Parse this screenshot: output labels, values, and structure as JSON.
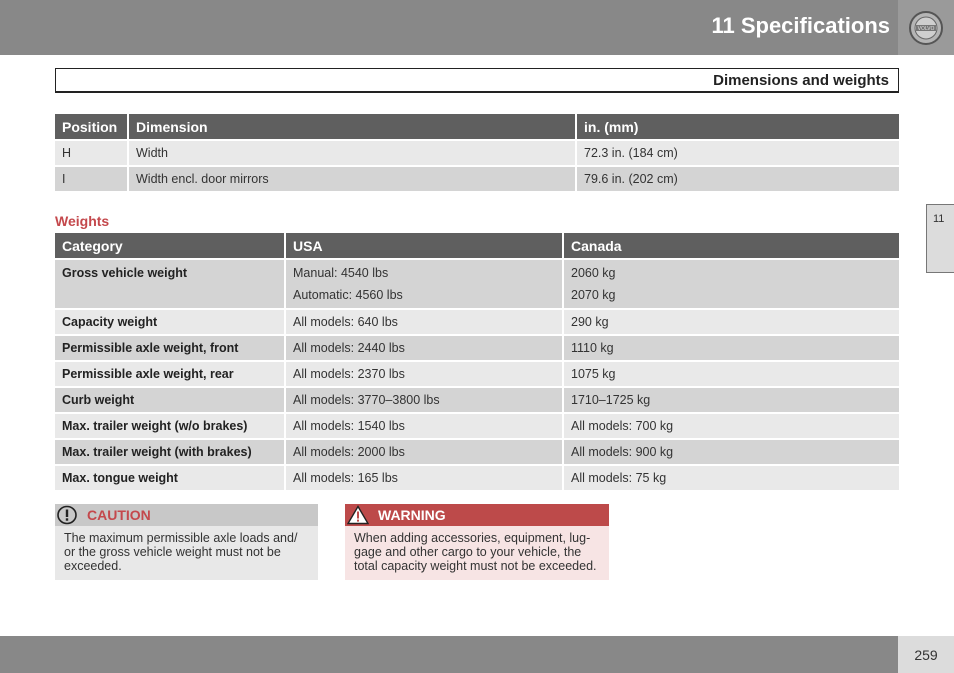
{
  "header": {
    "chapter_title": "11 Specifications",
    "emblem": "volvo-logo-icon"
  },
  "section": {
    "title": "Dimensions and weights"
  },
  "side_tab": {
    "label": "11"
  },
  "dimensions_table": {
    "headers": [
      "Position",
      "Dimension",
      "in. (mm)"
    ],
    "rows": [
      {
        "position": "H",
        "dimension": "Width",
        "value": "72.3 in. (184 cm)"
      },
      {
        "position": "I",
        "dimension": "Width encl. door mirrors",
        "value": "79.6 in. (202 cm)"
      }
    ]
  },
  "weights": {
    "heading": "Weights",
    "headers": [
      "Category",
      "USA",
      "Canada"
    ],
    "rows": [
      {
        "category": "Gross vehicle weight",
        "usa": [
          "Manual: 4540 lbs",
          "Automatic: 4560 lbs"
        ],
        "canada": [
          "2060 kg",
          "2070 kg"
        ]
      },
      {
        "category": "Capacity weight",
        "usa": [
          "All models: 640 lbs"
        ],
        "canada": [
          "290 kg"
        ]
      },
      {
        "category": "Permissible axle weight, front",
        "usa": [
          "All models: 2440 lbs"
        ],
        "canada": [
          "1110 kg"
        ]
      },
      {
        "category": "Permissible axle weight, rear",
        "usa": [
          "All models: 2370 lbs"
        ],
        "canada": [
          "1075 kg"
        ]
      },
      {
        "category": "Curb weight",
        "usa": [
          "All models: 3770–3800 lbs"
        ],
        "canada": [
          "1710–1725 kg"
        ]
      },
      {
        "category": "Max. trailer weight (w/o brakes)",
        "usa": [
          "All models: 1540 lbs"
        ],
        "canada": [
          "All models: 700 kg"
        ]
      },
      {
        "category": "Max. trailer weight (with brakes)",
        "usa": [
          "All models: 2000 lbs"
        ],
        "canada": [
          "All models: 900 kg"
        ]
      },
      {
        "category": "Max. tongue weight",
        "usa": [
          "All models: 165 lbs"
        ],
        "canada": [
          "All models: 75 kg"
        ]
      }
    ]
  },
  "caution": {
    "label": "CAUTION",
    "icon": "exclamation-circle-icon",
    "lines": [
      "The maximum permissible axle loads and/",
      "or the gross vehicle weight must not be",
      "exceeded."
    ]
  },
  "warning": {
    "label": "WARNING",
    "icon": "warning-triangle-icon",
    "lines": [
      "When adding accessories, equipment, lug-",
      "gage and other cargo to your vehicle, the",
      "total capacity weight must not be exceeded."
    ]
  },
  "footer": {
    "page_number": "259"
  },
  "colors": {
    "bar_gray": "#888888",
    "header_cell": "#5f5f5f",
    "row_dark": "#d4d4d4",
    "row_light": "#e9e9e9",
    "accent_red": "#c4484c",
    "warning_red": "#bd4a4a"
  }
}
